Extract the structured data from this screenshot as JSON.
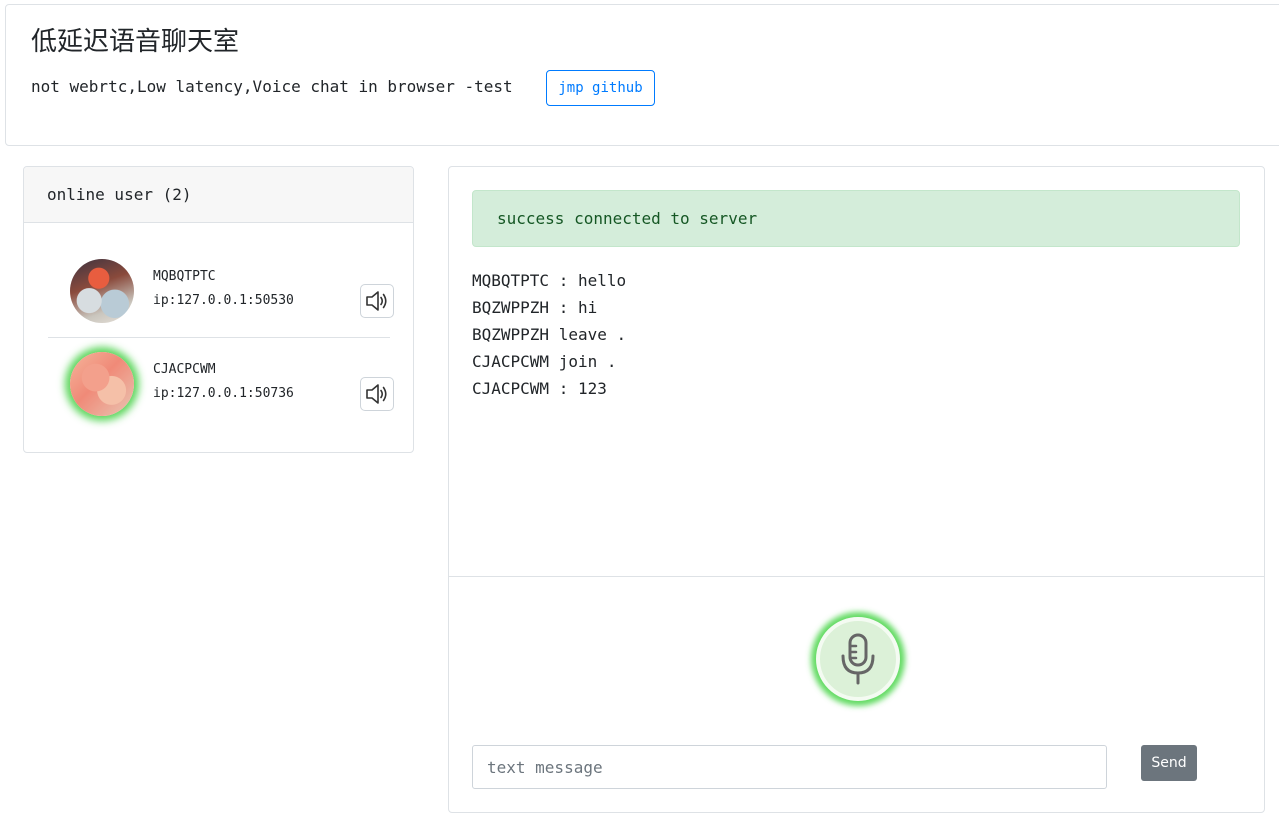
{
  "header": {
    "title": "低延迟语音聊天室",
    "subtitle": "not webrtc,Low latency,Voice chat in browser -test",
    "github_button": "jmp github"
  },
  "users": {
    "header": "online user (2)",
    "items": [
      {
        "name": "MQBQTPTC",
        "ip": "ip:127.0.0.1:50530",
        "speaking": false
      },
      {
        "name": "CJACPCWM",
        "ip": "ip:127.0.0.1:50736",
        "speaking": true
      }
    ]
  },
  "chat": {
    "status": "success connected to server",
    "messages": [
      "MQBQTPTC : hello",
      "BQZWPPZH : hi",
      "BQZWPPZH leave .",
      "CJACPCWM join .",
      "CJACPCWM : 123"
    ],
    "input_placeholder": "text message",
    "input_value": "",
    "send_button": "Send"
  },
  "colors": {
    "primary": "#007bff",
    "success_bg": "#d4edda",
    "success_text": "#155724",
    "secondary": "#6c757d",
    "speaking_glow": "#3cd23c"
  },
  "icons": {
    "speaker": "speaker-icon",
    "microphone": "microphone-icon"
  }
}
